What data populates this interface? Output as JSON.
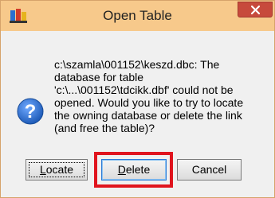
{
  "window": {
    "title": "Open Table"
  },
  "message": {
    "text": "c:\\szamla\\001152\\keszd.dbc: The\ndatabase for table\n'c:\\...\\001152\\tdcikk.dbf' could not be\nopened. Would you like to try to locate\nthe owning database or delete the link\n(and free the table)?"
  },
  "buttons": {
    "locate": {
      "mnemonic": "L",
      "rest": "ocate"
    },
    "delete": {
      "mnemonic": "D",
      "rest": "elete"
    },
    "cancel": {
      "label": "Cancel"
    }
  },
  "icons": {
    "app": "app-icon",
    "close": "close-icon",
    "question": "question-icon"
  },
  "colors": {
    "titlebar": "#f7c98b",
    "close_button": "#c74a3c",
    "highlight": "#e0141e",
    "question_icon": "#1e5bb8"
  }
}
